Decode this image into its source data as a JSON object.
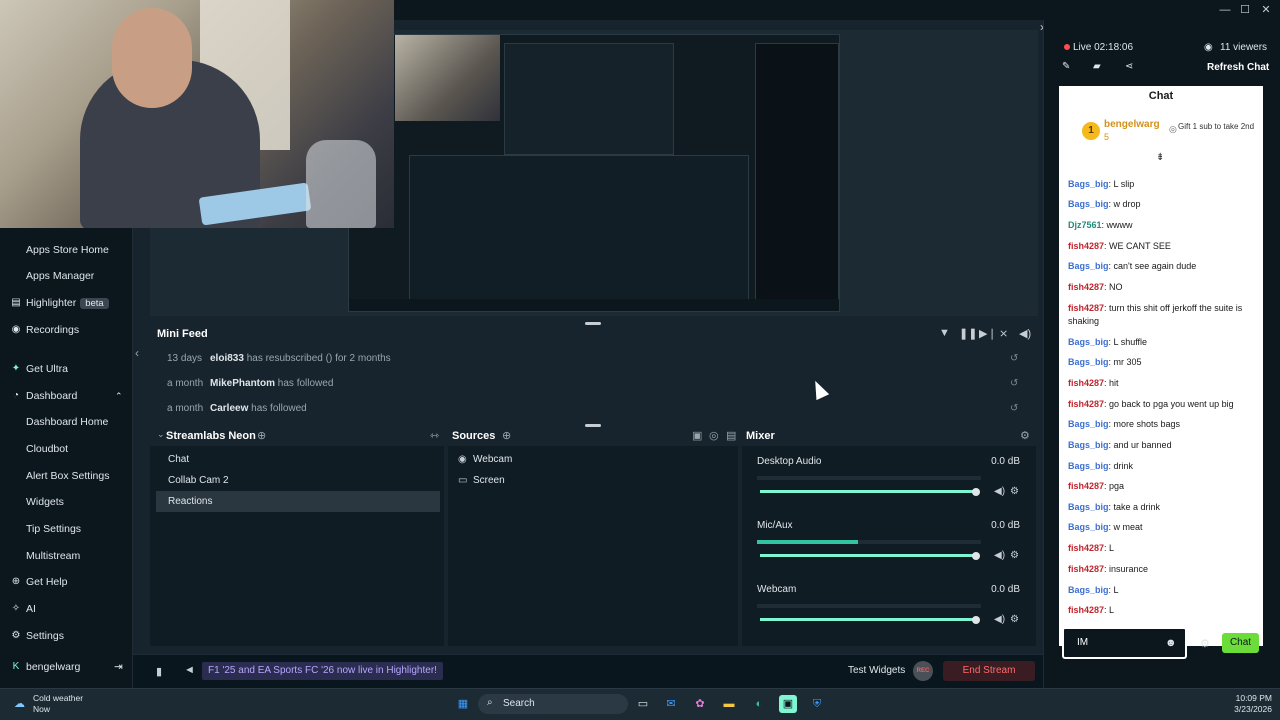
{
  "sidebar": {
    "items": [
      {
        "label": "Apps Store Home",
        "icon": "none"
      },
      {
        "label": "Apps Manager",
        "icon": "none"
      },
      {
        "label": "Highlighter",
        "icon": "highlighter-icon",
        "badge": "beta"
      },
      {
        "label": "Recordings",
        "icon": "record-icon"
      },
      {
        "label": "Get Ultra",
        "icon": "ultra-icon"
      },
      {
        "label": "Dashboard",
        "icon": "dashboard-icon",
        "expanded": true
      },
      {
        "label": "Dashboard Home",
        "icon": "none"
      },
      {
        "label": "Cloudbot",
        "icon": "none"
      },
      {
        "label": "Alert Box Settings",
        "icon": "none"
      },
      {
        "label": "Widgets",
        "icon": "none"
      },
      {
        "label": "Tip Settings",
        "icon": "none"
      },
      {
        "label": "Multistream",
        "icon": "none"
      },
      {
        "label": "Get Help",
        "icon": "help-icon"
      },
      {
        "label": "AI",
        "icon": "ai-icon"
      },
      {
        "label": "Settings",
        "icon": "gear-icon"
      }
    ],
    "user": "bengelwarg"
  },
  "mini_feed": {
    "title": "Mini Feed",
    "rows": [
      {
        "ago": "13 days",
        "user": "eloi833",
        "action": "has resubscribed () for 2 months"
      },
      {
        "ago": "a month",
        "user": "MikePhantom",
        "action": "has followed"
      },
      {
        "ago": "a month",
        "user": "Carleew",
        "action": "has followed"
      }
    ]
  },
  "scenes": {
    "title": "Streamlabs Neon",
    "items": [
      "Chat",
      "Collab Cam 2",
      "Reactions"
    ],
    "selected": "Reactions"
  },
  "sources": {
    "title": "Sources",
    "items": [
      {
        "label": "Webcam",
        "icon": "camera-icon"
      },
      {
        "label": "Screen",
        "icon": "monitor-icon"
      }
    ]
  },
  "mixer": {
    "title": "Mixer",
    "channels": [
      {
        "name": "Desktop Audio",
        "db": "0.0 dB",
        "level": 0
      },
      {
        "name": "Mic/Aux",
        "db": "0.0 dB",
        "level": 0.45
      },
      {
        "name": "Webcam",
        "db": "0.0 dB",
        "level": 0
      }
    ]
  },
  "footer": {
    "promo": "F1 '25 and EA Sports FC '26 now live in Highlighter!",
    "test_widgets": "Test Widgets",
    "rec": "REC",
    "end_stream": "End Stream"
  },
  "chat_panel": {
    "live": "Live 02:18:06",
    "viewers": "11 viewers",
    "refresh": "Refresh Chat",
    "title": "Chat",
    "gift": {
      "user": "bengelwarg",
      "count": "5",
      "text": "Gift 1 sub to take 2nd"
    },
    "messages": [
      {
        "user": "Bags_big",
        "text": ": L slip",
        "color": "blue"
      },
      {
        "user": "Bags_big",
        "text": ": w drop",
        "color": "blue"
      },
      {
        "user": "Djz7561",
        "text": ": wwww",
        "color": "teal"
      },
      {
        "user": "fish4287",
        "text": ": WE CANT SEE",
        "color": "red"
      },
      {
        "user": "Bags_big",
        "text": ": can't see again dude",
        "color": "blue"
      },
      {
        "user": "fish4287",
        "text": ": NO",
        "color": "red"
      },
      {
        "user": "fish4287",
        "text": ": turn this shit off jerkoff the suite is shaking",
        "color": "red"
      },
      {
        "user": "Bags_big",
        "text": ": L shuffle",
        "color": "blue"
      },
      {
        "user": "Bags_big",
        "text": ": mr 305",
        "color": "blue"
      },
      {
        "user": "fish4287",
        "text": ": hit",
        "color": "red"
      },
      {
        "user": "fish4287",
        "text": ": go back to pga you went up big",
        "color": "red"
      },
      {
        "user": "Bags_big",
        "text": ": more shots bags",
        "color": "blue"
      },
      {
        "user": "Bags_big",
        "text": ": and ur banned",
        "color": "blue"
      },
      {
        "user": "Bags_big",
        "text": ": drink",
        "color": "blue"
      },
      {
        "user": "fish4287",
        "text": ": pga",
        "color": "red"
      },
      {
        "user": "Bags_big",
        "text": ": take a drink",
        "color": "blue"
      },
      {
        "user": "Bags_big",
        "text": ": w meat",
        "color": "blue"
      },
      {
        "user": "fish4287",
        "text": ": L",
        "color": "red"
      },
      {
        "user": "fish4287",
        "text": ": insurance",
        "color": "red"
      },
      {
        "user": "Bags_big",
        "text": ": L",
        "color": "blue"
      },
      {
        "user": "fish4287",
        "text": ": L",
        "color": "red"
      }
    ],
    "input_value": "IM",
    "send": "Chat"
  },
  "taskbar": {
    "weather_title": "Cold weather",
    "weather_sub": "Now",
    "search": "Search",
    "time": "10:09 PM",
    "date": "3/23/2026"
  }
}
